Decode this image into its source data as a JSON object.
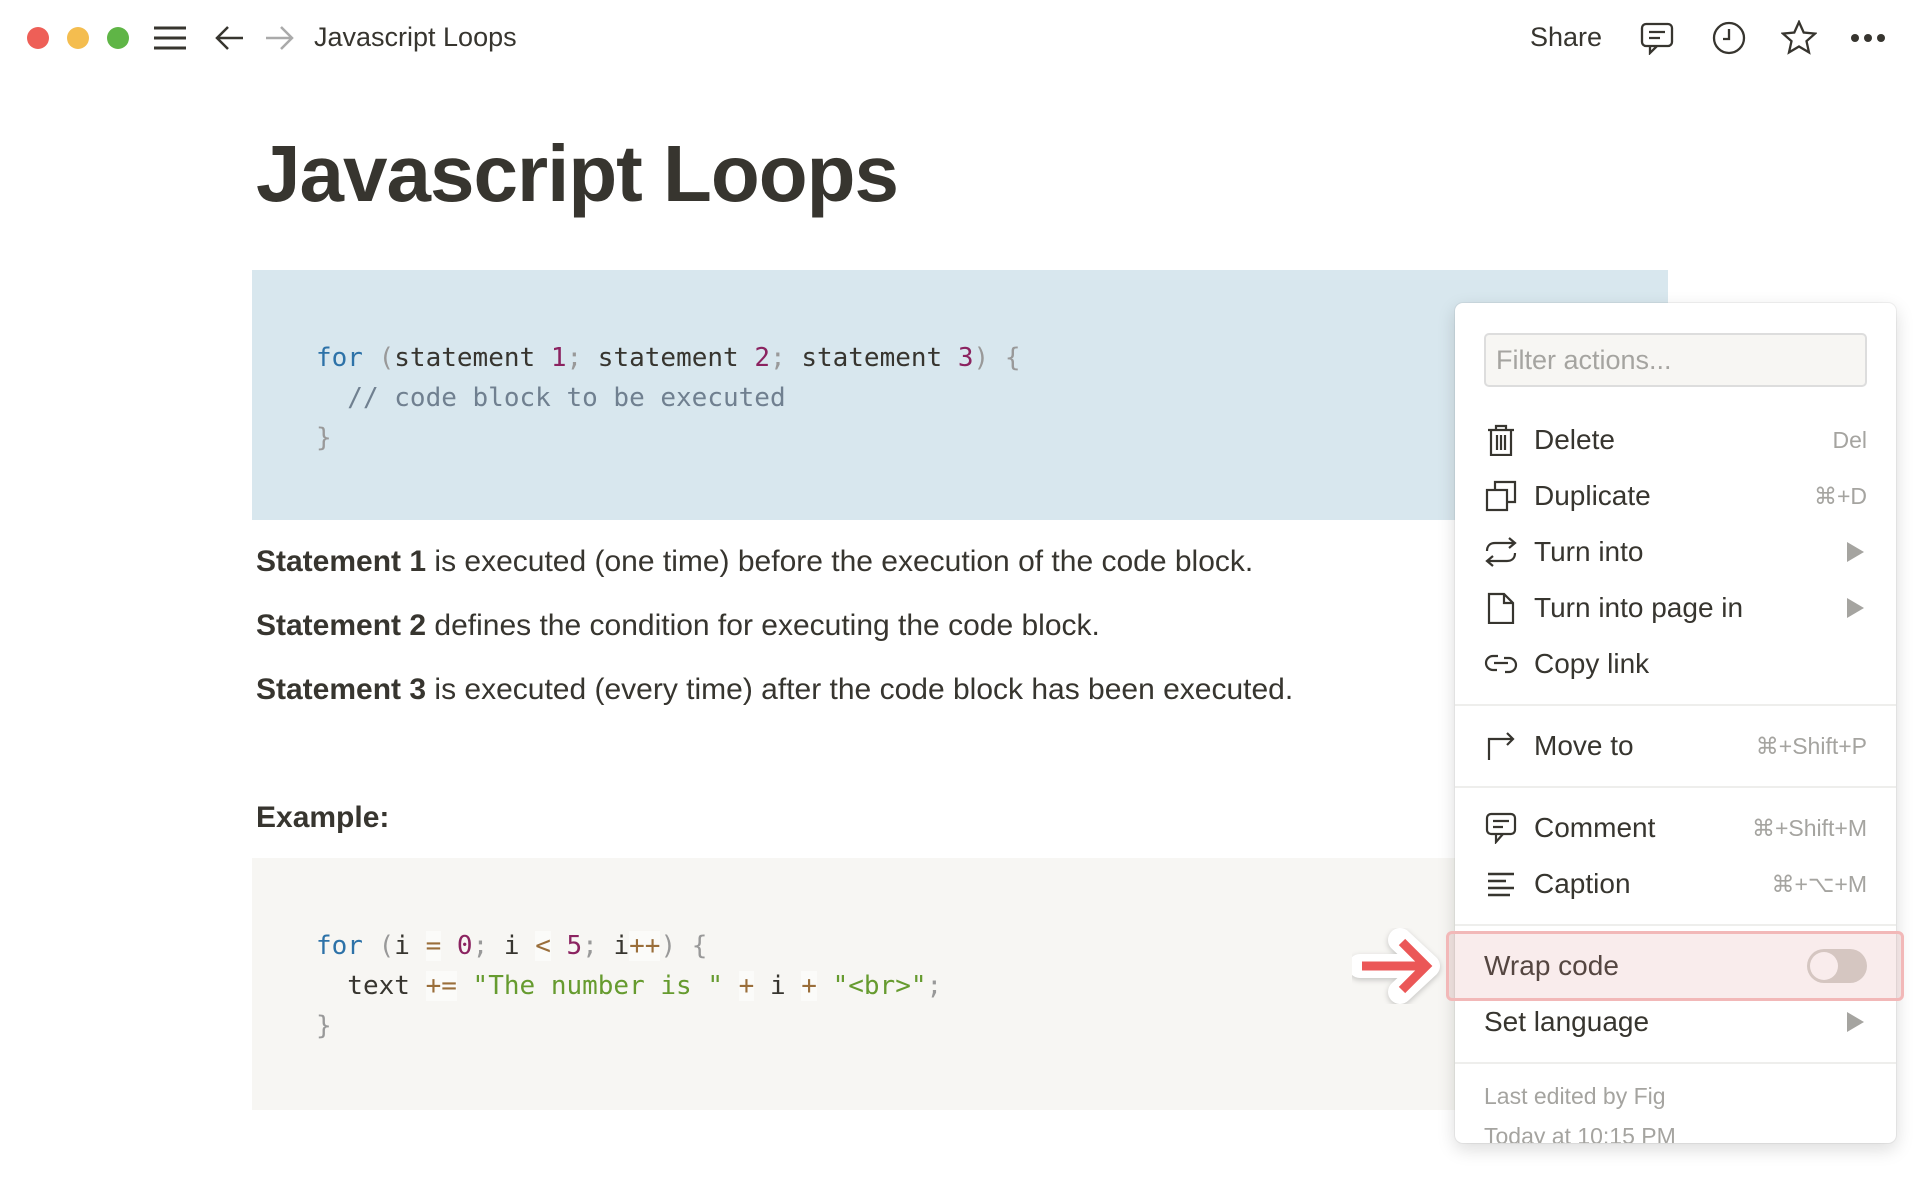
{
  "window": {
    "title": "Javascript Loops",
    "traffic_lights": {
      "close": "#ee5f57",
      "minimize": "#f4bd4f",
      "maximize": "#5fb546"
    },
    "share_label": "Share",
    "icons": [
      "menu-icon",
      "back-arrow-icon",
      "forward-arrow-icon",
      "comment-icon",
      "clock-icon",
      "star-icon",
      "more-icon"
    ]
  },
  "page": {
    "title": "Javascript Loops",
    "code_block_1": {
      "lines": [
        [
          {
            "t": "kw",
            "v": "for"
          },
          {
            "t": "pn",
            "v": " ("
          },
          {
            "t": "id",
            "v": "statement "
          },
          {
            "t": "nm",
            "v": "1"
          },
          {
            "t": "pn",
            "v": "; "
          },
          {
            "t": "id",
            "v": "statement "
          },
          {
            "t": "nm",
            "v": "2"
          },
          {
            "t": "pn",
            "v": "; "
          },
          {
            "t": "id",
            "v": "statement "
          },
          {
            "t": "nm",
            "v": "3"
          },
          {
            "t": "pn",
            "v": ") {"
          }
        ],
        [
          {
            "t": "cm",
            "v": "  // code block to be executed"
          }
        ],
        [
          {
            "t": "pn",
            "v": "}"
          }
        ]
      ]
    },
    "paragraphs": [
      {
        "bold": "Statement 1",
        "text": " is executed (one time) before the execution of the code block."
      },
      {
        "bold": "Statement 2",
        "text": " defines the condition for executing the code block."
      },
      {
        "bold": "Statement 3",
        "text": " is executed (every time) after the code block has been executed."
      }
    ],
    "example_heading": "Example:",
    "code_block_2": {
      "lines": [
        [
          {
            "t": "kw",
            "v": "for"
          },
          {
            "t": "pn",
            "v": " ("
          },
          {
            "t": "id",
            "v": "i "
          },
          {
            "t": "op",
            "v": "="
          },
          {
            "t": "id",
            "v": " "
          },
          {
            "t": "nm",
            "v": "0"
          },
          {
            "t": "pn",
            "v": "; "
          },
          {
            "t": "id",
            "v": "i "
          },
          {
            "t": "op",
            "v": "<"
          },
          {
            "t": "id",
            "v": " "
          },
          {
            "t": "nm",
            "v": "5"
          },
          {
            "t": "pn",
            "v": "; "
          },
          {
            "t": "id",
            "v": "i"
          },
          {
            "t": "op",
            "v": "++"
          },
          {
            "t": "pn",
            "v": ") {"
          }
        ],
        [
          {
            "t": "id",
            "v": "  text "
          },
          {
            "t": "op",
            "v": "+="
          },
          {
            "t": "id",
            "v": " "
          },
          {
            "t": "st",
            "v": "\"The number is \""
          },
          {
            "t": "id",
            "v": " "
          },
          {
            "t": "op",
            "v": "+"
          },
          {
            "t": "id",
            "v": " i "
          },
          {
            "t": "op",
            "v": "+"
          },
          {
            "t": "id",
            "v": " "
          },
          {
            "t": "st",
            "v": "\"<br>\""
          },
          {
            "t": "pn",
            "v": ";"
          }
        ],
        [
          {
            "t": "pn",
            "v": "}"
          }
        ]
      ]
    }
  },
  "context_menu": {
    "filter_placeholder": "Filter actions...",
    "items": [
      {
        "label": "Delete",
        "shortcut": "Del",
        "icon": "trash-icon"
      },
      {
        "label": "Duplicate",
        "shortcut": "⌘+D",
        "icon": "duplicate-icon"
      },
      {
        "label": "Turn into",
        "submenu": true,
        "icon": "turn-into-icon"
      },
      {
        "label": "Turn into page in",
        "submenu": true,
        "icon": "page-icon"
      },
      {
        "label": "Copy link",
        "icon": "link-icon"
      },
      {
        "label": "Move to",
        "shortcut": "⌘+Shift+P",
        "icon": "move-to-icon"
      },
      {
        "label": "Comment",
        "shortcut": "⌘+Shift+M",
        "icon": "comment-icon"
      },
      {
        "label": "Caption",
        "shortcut": "⌘+⌥+M",
        "icon": "caption-icon"
      },
      {
        "label": "Wrap code",
        "toggle": false
      },
      {
        "label": "Set language",
        "submenu": true
      }
    ],
    "last_edited_by": "Last edited by Fig",
    "last_edited_time": "Today at 10:15 PM",
    "highlight_color": "#eb5757"
  }
}
